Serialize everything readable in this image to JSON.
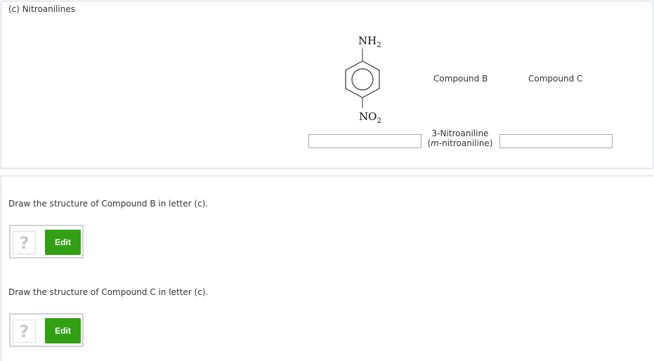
{
  "part": {
    "label": "(c) Nitroanilines"
  },
  "molecule": {
    "top_group": "NH",
    "top_group_sub": "2",
    "bottom_group": "NO",
    "bottom_group_sub": "2"
  },
  "compounds": {
    "b_header": "Compound B",
    "c_header": "Compound C",
    "given_name_line1": "3-Nitroaniline",
    "given_name_line2_open": "(",
    "given_name_line2_italic": "m",
    "given_name_line2_rest": "-nitroaniline)",
    "answer_left_value": "",
    "answer_right_value": ""
  },
  "questions": [
    {
      "prompt": "Draw the structure of Compound B in letter (c).",
      "placeholder_glyph": "?",
      "edit_label": "Edit"
    },
    {
      "prompt": "Draw the structure of Compound C in letter (c).",
      "placeholder_glyph": "?",
      "edit_label": "Edit"
    }
  ],
  "colors": {
    "edit_button": "#31a013",
    "panel_border": "#cdd7e3"
  }
}
